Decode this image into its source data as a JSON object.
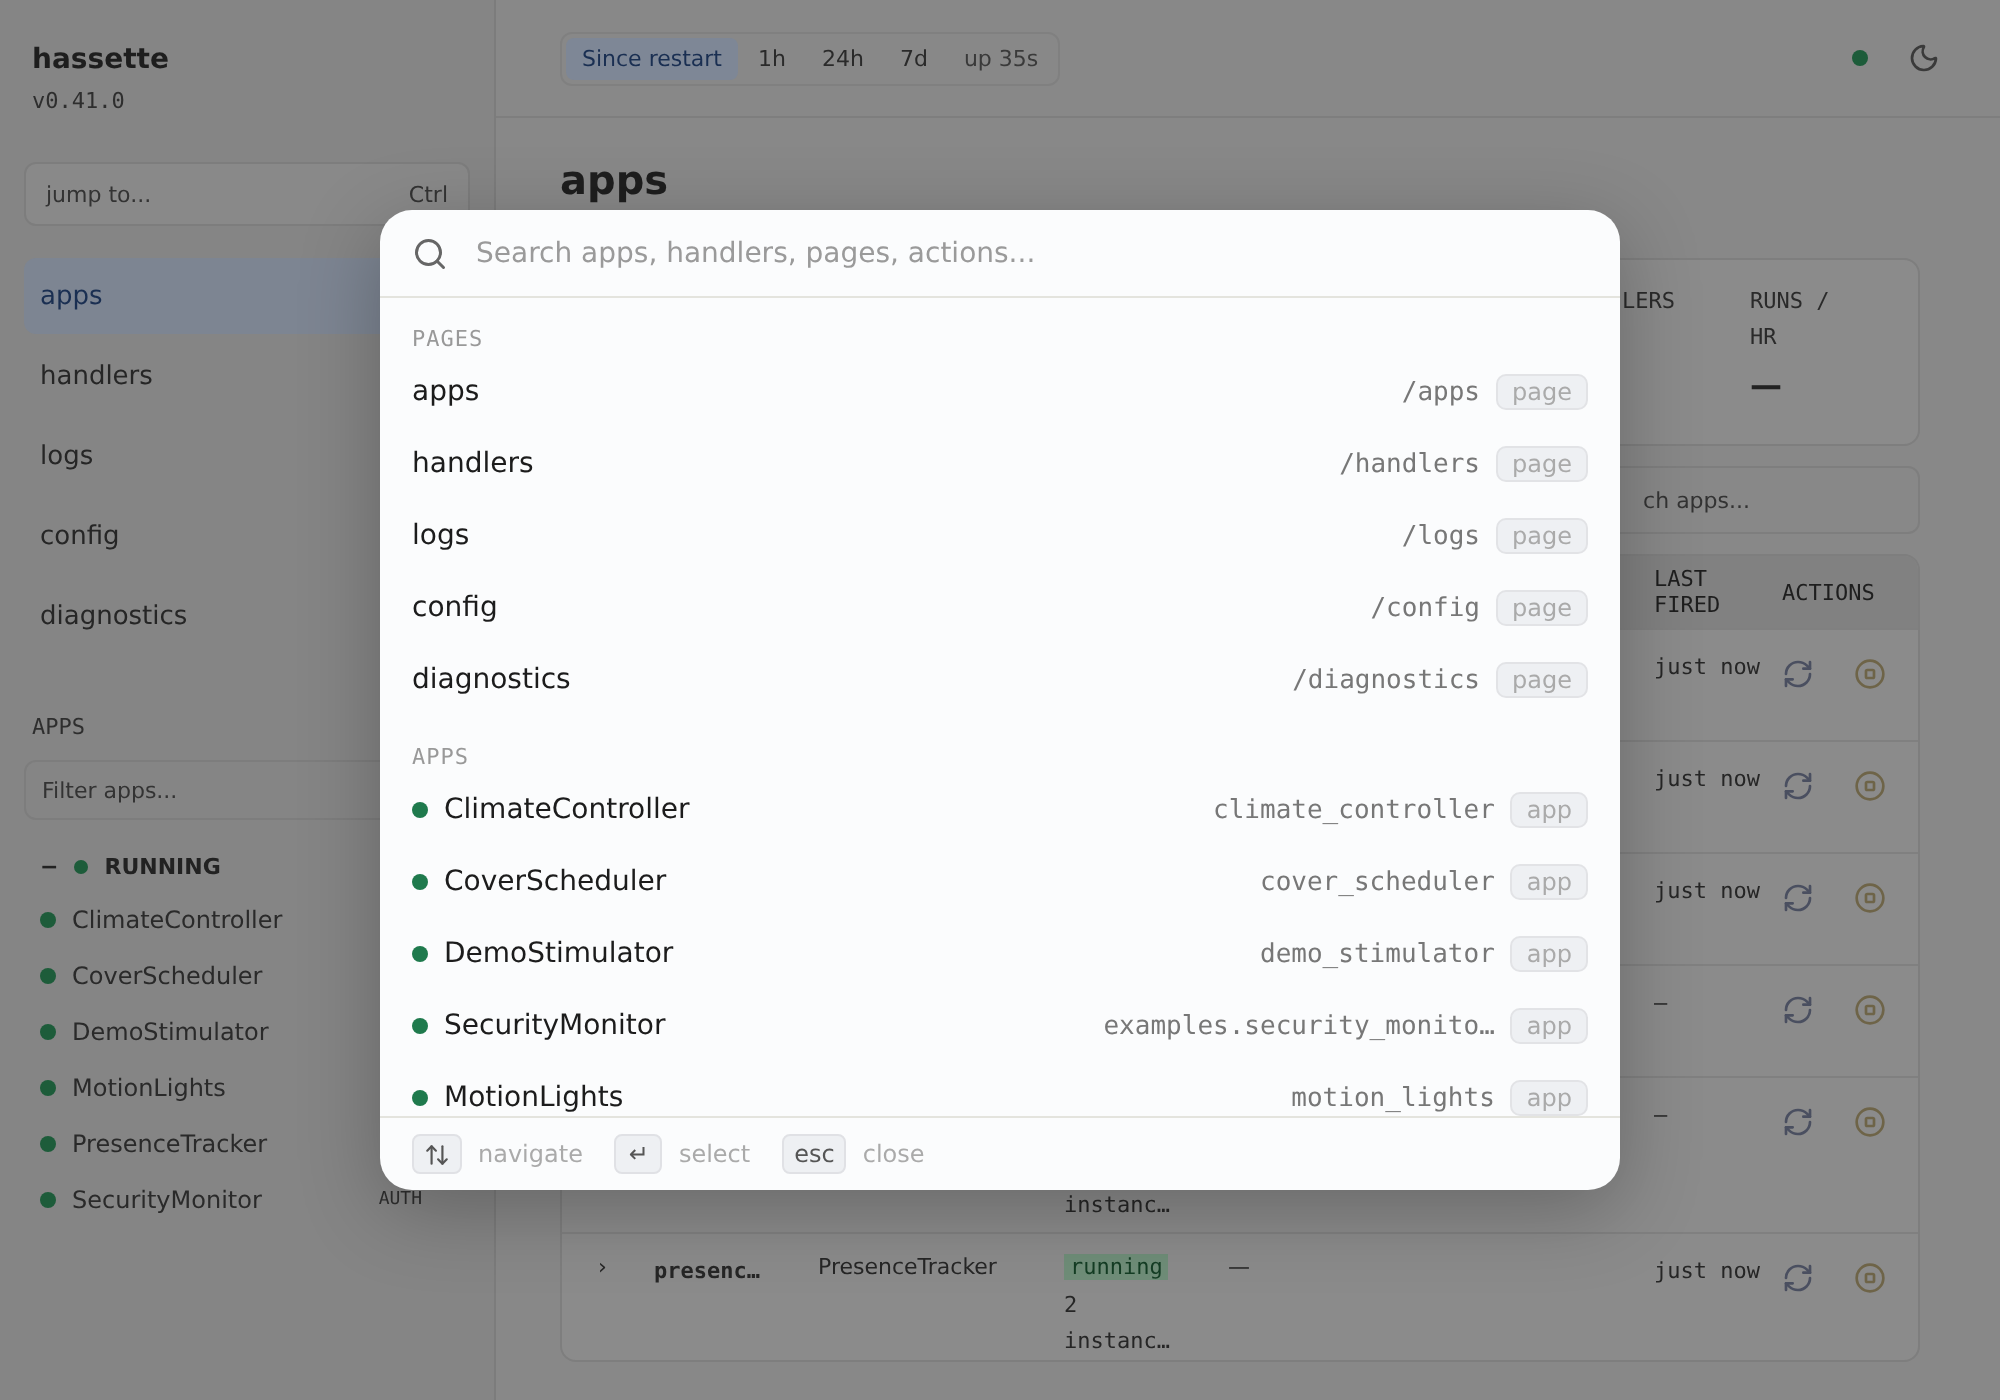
{
  "sidebar": {
    "title": "hassette",
    "version": "v0.41.0",
    "jump": {
      "placeholder": "jump to...",
      "shortcut": "Ctrl"
    },
    "nav": [
      {
        "label": "apps",
        "selected": true
      },
      {
        "label": "handlers",
        "selected": false
      },
      {
        "label": "logs",
        "selected": false
      },
      {
        "label": "config",
        "selected": false
      },
      {
        "label": "diagnostics",
        "selected": false
      }
    ],
    "apps_label": "APPS",
    "filter": {
      "placeholder": "Filter apps..."
    },
    "group": {
      "toggle": "−",
      "label": "RUNNING",
      "color": "#1d5c3a",
      "expanded": true,
      "items": [
        {
          "name": "ClimateController",
          "color": "#1d5c3a"
        },
        {
          "name": "CoverScheduler",
          "color": "#1d5c3a"
        },
        {
          "name": "DemoStimulator",
          "color": "#1d5c3a"
        },
        {
          "name": "MotionLights",
          "color": "#1d5c3a"
        },
        {
          "name": "PresenceTracker",
          "color": "#1d5c3a"
        },
        {
          "name": "SecurityMonitor",
          "color": "#1d5c3a",
          "tag": "AUTH"
        }
      ]
    }
  },
  "topbar": {
    "ranges": [
      {
        "label": "Since restart",
        "selected": true
      },
      {
        "label": "1h",
        "selected": false
      },
      {
        "label": "24h",
        "selected": false
      },
      {
        "label": "7d",
        "selected": false
      }
    ],
    "uptime": "up 35s"
  },
  "main": {
    "heading": "apps",
    "stats": [
      {
        "label": "LERS"
      },
      {
        "label": "RUNS / HR",
        "value": "—"
      }
    ],
    "search": {
      "placeholder": "ch apps..."
    },
    "table": {
      "columns": [
        "LAST FIRED",
        "ACTIONS"
      ],
      "rows": [
        {
          "last_fired": "just now"
        },
        {
          "last_fired": "just now"
        },
        {
          "last_fired": "just now"
        },
        {
          "last_fired": "—"
        },
        {
          "last_fired": "—",
          "instances": "instanc…"
        },
        {
          "expand": "›",
          "name": "presenc…",
          "class": "PresenceTracker",
          "status": "running",
          "instances": "2\ninstanc…",
          "runs": "—",
          "last_fired": "just now"
        }
      ]
    }
  },
  "palette": {
    "search": {
      "placeholder": "Search apps, handlers, pages, actions..."
    },
    "sections": [
      {
        "label": "PAGES",
        "items": [
          {
            "kind": "page",
            "name": "apps",
            "path": "/apps",
            "tag": "page"
          },
          {
            "kind": "page",
            "name": "handlers",
            "path": "/handlers",
            "tag": "page"
          },
          {
            "kind": "page",
            "name": "logs",
            "path": "/logs",
            "tag": "page"
          },
          {
            "kind": "page",
            "name": "config",
            "path": "/config",
            "tag": "page"
          },
          {
            "kind": "page",
            "name": "diagnostics",
            "path": "/diagnostics",
            "tag": "page"
          }
        ]
      },
      {
        "label": "APPS",
        "items": [
          {
            "kind": "app",
            "name": "ClimateController",
            "path": "climate_controller",
            "tag": "app",
            "color": "#1f7a4d"
          },
          {
            "kind": "app",
            "name": "CoverScheduler",
            "path": "cover_scheduler",
            "tag": "app",
            "color": "#1f7a4d"
          },
          {
            "kind": "app",
            "name": "DemoStimulator",
            "path": "demo_stimulator",
            "tag": "app",
            "color": "#1f7a4d"
          },
          {
            "kind": "app",
            "name": "SecurityMonitor",
            "path": "examples.security_monito…",
            "tag": "app",
            "color": "#1f7a4d"
          },
          {
            "kind": "app",
            "name": "MotionLights",
            "path": "motion_lights",
            "tag": "app",
            "color": "#1f7a4d"
          }
        ]
      }
    ],
    "footer": [
      {
        "kind": "icon",
        "label": "navigate"
      },
      {
        "kind": "text",
        "key": "↵",
        "label": "select"
      },
      {
        "kind": "text",
        "key": "esc",
        "label": "close"
      }
    ]
  }
}
